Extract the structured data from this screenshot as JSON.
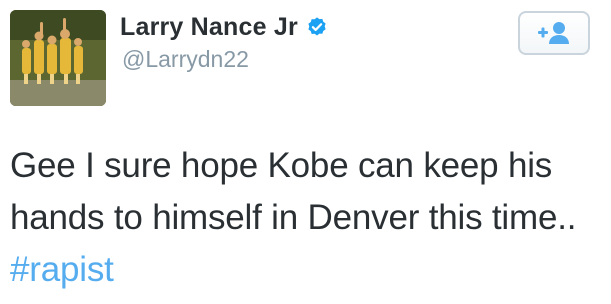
{
  "user": {
    "display_name": "Larry Nance Jr",
    "handle": "@Larrydn22",
    "verified": true,
    "avatar_icon": "avatar-basketball-team-photo"
  },
  "follow_button": {
    "icon": "follow-user-plus-icon"
  },
  "tweet": {
    "text_main": "Gee I sure hope Kobe can keep his hands to himself in Denver this time.. ",
    "hashtag": "#rapist"
  },
  "colors": {
    "text": "#292f33",
    "secondary": "#8899a6",
    "link": "#55acee",
    "verified": "#1da1f2"
  }
}
